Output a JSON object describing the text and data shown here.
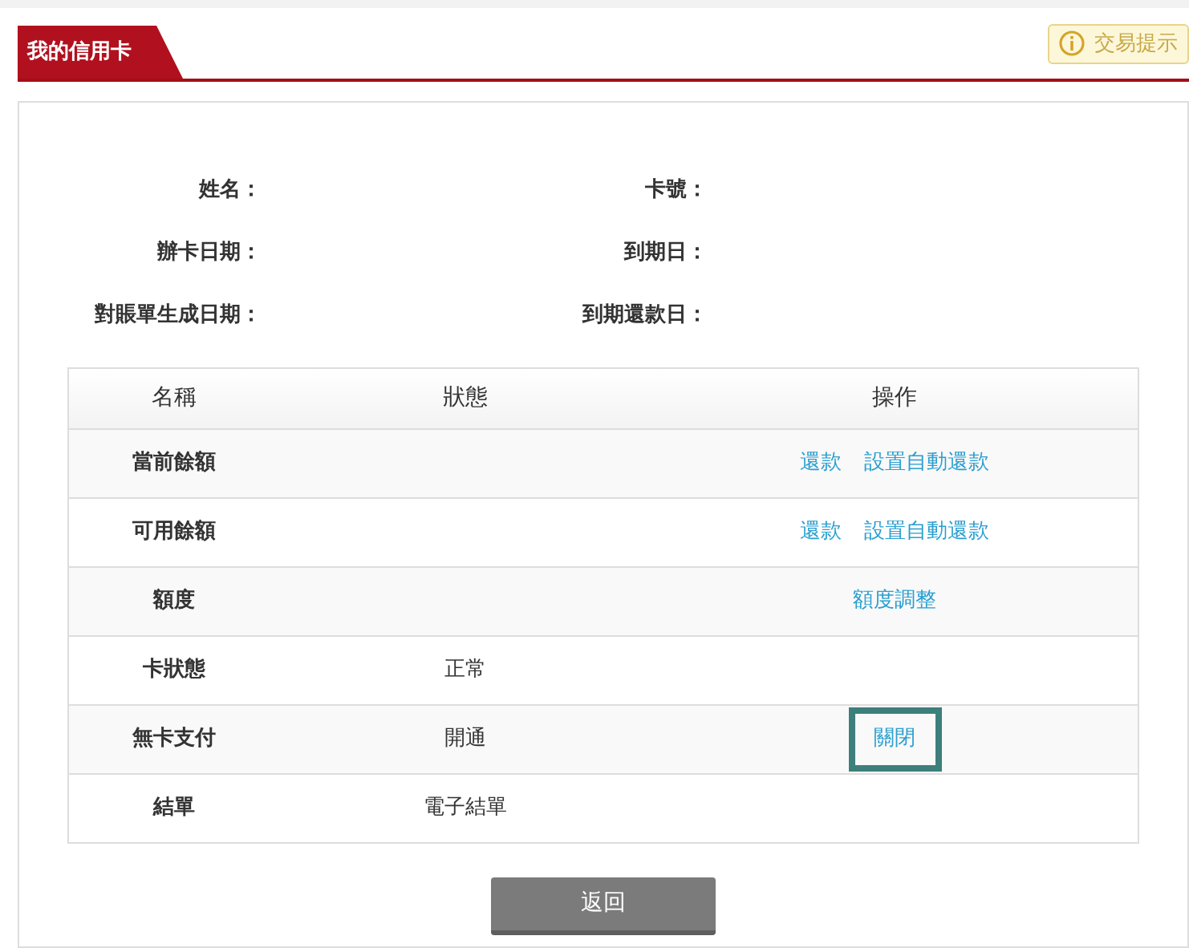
{
  "header": {
    "title": "我的信用卡",
    "tip_button": "交易提示"
  },
  "info": [
    {
      "label": "姓名：",
      "label_2": "卡號："
    },
    {
      "label": "辦卡日期：",
      "label_2": "到期日："
    },
    {
      "label": "對賬單生成日期：",
      "label_2": "到期還款日："
    }
  ],
  "table": {
    "columns": [
      "名稱",
      "狀態",
      "操作"
    ],
    "rows": [
      {
        "name": "當前餘額",
        "actions": [
          {
            "label": "還款",
            "highlighted": false
          },
          {
            "label": "設置自動還款",
            "highlighted": false
          }
        ]
      },
      {
        "name": "可用餘額",
        "actions": [
          {
            "label": "還款",
            "highlighted": false
          },
          {
            "label": "設置自動還款",
            "highlighted": false
          }
        ]
      },
      {
        "name": "額度",
        "actions": [
          {
            "label": "額度調整",
            "highlighted": false
          }
        ]
      },
      {
        "name": "卡狀態",
        "status": "正常"
      },
      {
        "name": "無卡支付",
        "status": "開通",
        "actions": [
          {
            "label": "關閉",
            "highlighted": true
          }
        ]
      },
      {
        "name": "結單",
        "status": "電子結單"
      }
    ]
  },
  "back_button": "返回"
}
